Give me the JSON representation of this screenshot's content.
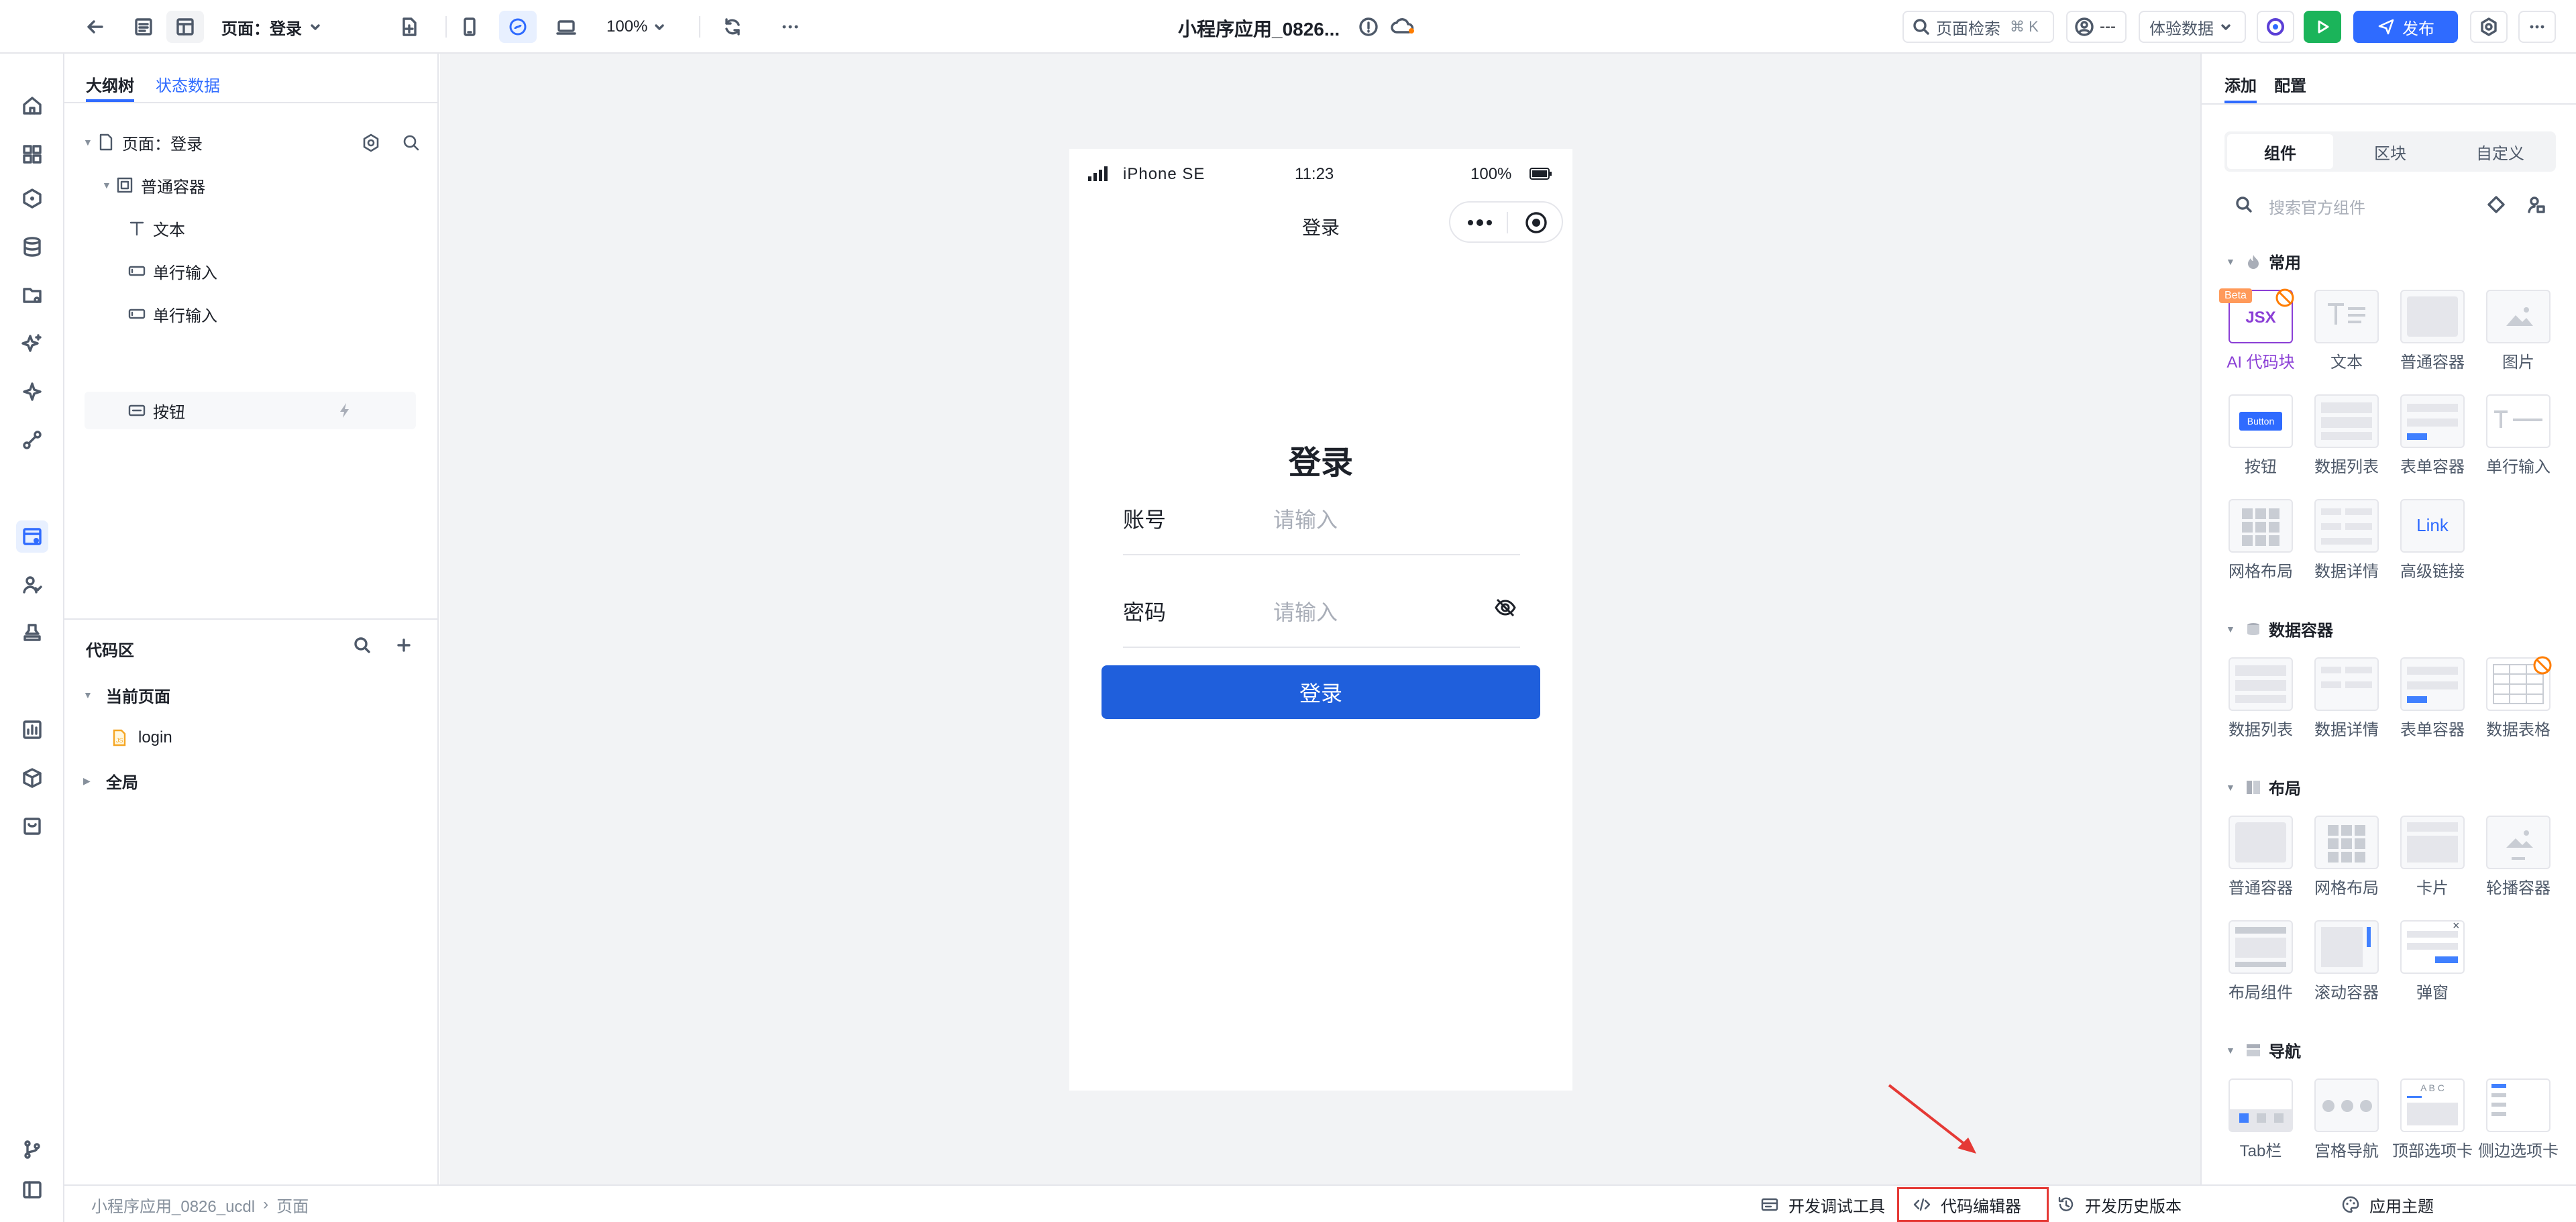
{
  "topbar": {
    "page_selector": "页面：登录",
    "zoom": "100%",
    "app_title": "小程序应用_0826...",
    "search_label": "页面检索",
    "search_shortcut": "⌘ K",
    "user_label": "---",
    "experience_data": "体验数据",
    "publish": "发布"
  },
  "outline": {
    "tabs": [
      "大纲树",
      "状态数据"
    ],
    "tree": [
      {
        "label": "页面：登录",
        "icon": "page-icon"
      },
      {
        "label": "普通容器",
        "icon": "container-icon"
      },
      {
        "label": "文本",
        "icon": "text-icon"
      },
      {
        "label": "单行输入",
        "icon": "input-icon"
      },
      {
        "label": "单行输入",
        "icon": "input-icon"
      },
      {
        "label": "按钮",
        "icon": "button-icon"
      }
    ]
  },
  "code_area": {
    "title": "代码区",
    "current_page": "当前页面",
    "file": "login",
    "global": "全局"
  },
  "phone": {
    "carrier": "iPhone SE",
    "time": "11:23",
    "battery": "100%",
    "nav_title": "登录",
    "heading": "登录",
    "account_label": "账号",
    "account_placeholder": "请输入",
    "password_label": "密码",
    "password_placeholder": "请输入",
    "login_button": "登录"
  },
  "rpanel": {
    "tabs": [
      "添加",
      "配置"
    ],
    "segments": [
      "组件",
      "区块",
      "自定义"
    ],
    "search_placeholder": "搜索官方组件",
    "sections": {
      "common": "常用",
      "data": "数据容器",
      "layout": "布局",
      "nav": "导航"
    },
    "common_items": [
      "AI 代码块",
      "文本",
      "普通容器",
      "图片",
      "按钮",
      "数据列表",
      "表单容器",
      "单行输入",
      "网格布局",
      "数据详情",
      "高级链接"
    ],
    "data_items": [
      "数据列表",
      "数据详情",
      "表单容器",
      "数据表格"
    ],
    "layout_items": [
      "普通容器",
      "网格布局",
      "卡片",
      "轮播容器",
      "布局组件",
      "滚动容器",
      "弹窗"
    ],
    "nav_items": [
      "Tab栏",
      "宫格导航",
      "顶部选项卡",
      "侧边选项卡"
    ],
    "beta": "Beta",
    "jsx": "JSX",
    "thumb_button": "Button",
    "thumb_link": "Link",
    "thumb_abc": "A B C"
  },
  "bottombar": {
    "breadcrumb": [
      "小程序应用_0826_ucdl",
      "页面"
    ],
    "debug": "开发调试工具",
    "code_editor": "代码编辑器",
    "history": "开发历史版本",
    "theme": "应用主题"
  },
  "colors": {
    "primary": "#1f5fdc",
    "accent": "#2f6bff",
    "publish_bg": "#2f6bff",
    "run_green": "#1bb45a",
    "annotation": "#e53935",
    "ai_purple": "#8b3fd6"
  }
}
